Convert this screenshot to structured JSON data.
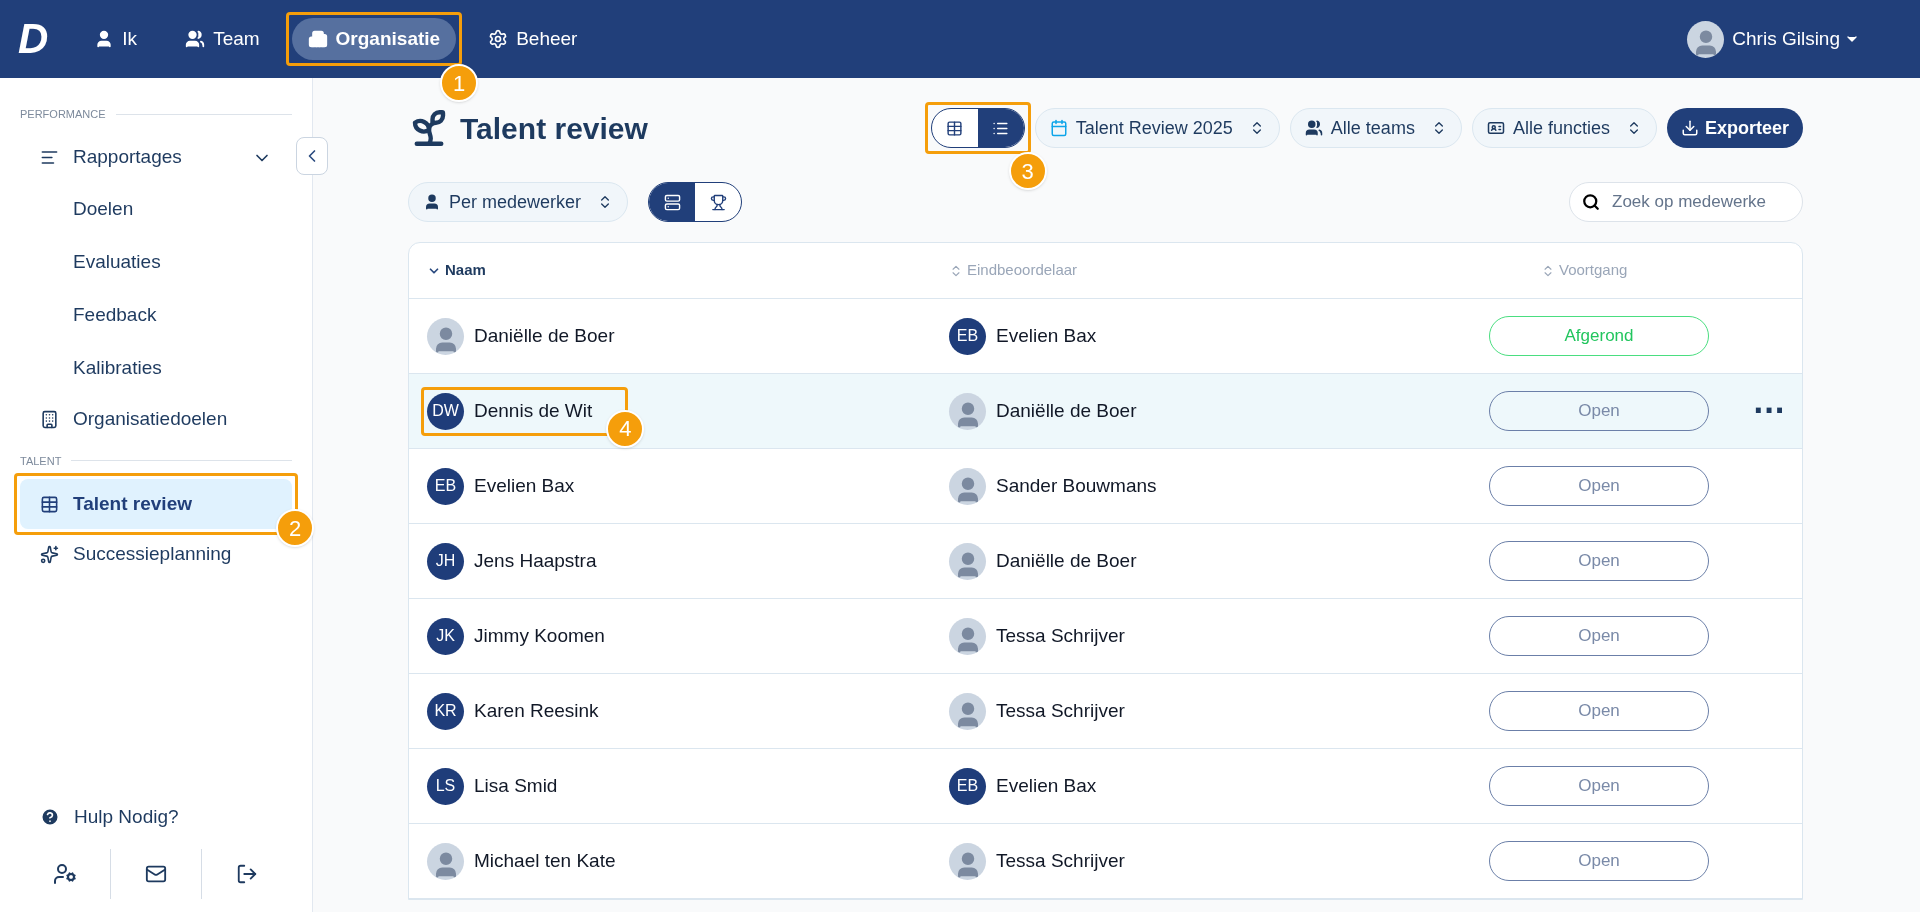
{
  "topbar": {
    "logo": "D",
    "nav": [
      {
        "label": "Ik",
        "selected": false
      },
      {
        "label": "Team",
        "selected": false
      },
      {
        "label": "Organisatie",
        "selected": true,
        "callout": "1"
      },
      {
        "label": "Beheer",
        "selected": false
      }
    ],
    "user": {
      "name": "Chris Gilsing"
    }
  },
  "sidebar": {
    "sections": [
      {
        "label": "PERFORMANCE",
        "items": [
          {
            "label": "Rapportages",
            "expanded": true,
            "selected": false,
            "children": [
              {
                "label": "Doelen",
                "selected": false
              },
              {
                "label": "Evaluaties",
                "selected": false
              },
              {
                "label": "Feedback",
                "selected": false
              },
              {
                "label": "Kalibraties",
                "selected": false
              }
            ]
          },
          {
            "label": "Organisatiedoelen",
            "selected": false
          }
        ]
      },
      {
        "label": "TALENT",
        "items": [
          {
            "label": "Talent review",
            "selected": true,
            "callout": "2"
          },
          {
            "label": "Successieplanning",
            "selected": false
          }
        ]
      }
    ],
    "help": "Hulp Nodig?"
  },
  "page": {
    "title": "Talent review",
    "view_toggle": {
      "callout": "3",
      "options": [
        {
          "selected": false
        },
        {
          "selected": true
        }
      ]
    },
    "filters": [
      {
        "label": "Talent Review 2025"
      },
      {
        "label": "Alle teams"
      },
      {
        "label": "Alle functies"
      }
    ],
    "export": "Exporteer",
    "group_select": "Per medewerker",
    "mode_toggle": [
      {
        "selected": true
      },
      {
        "selected": false
      }
    ],
    "search": {
      "placeholder": "Zoek op medewerke"
    }
  },
  "table": {
    "columns": [
      {
        "label": "Naam",
        "sorted": true
      },
      {
        "label": "Eindbeoordelaar",
        "sorted": false
      },
      {
        "label": "Voortgang",
        "sorted": false
      }
    ],
    "rows": [
      {
        "name": {
          "label": "Daniëlle de Boer",
          "avatar": {
            "kind": "photo"
          }
        },
        "reviewer": {
          "label": "Evelien Bax",
          "avatar": {
            "kind": "initials",
            "initials": "EB"
          }
        },
        "status": {
          "label": "Afgerond",
          "kind": "done"
        },
        "selected": false
      },
      {
        "name": {
          "label": "Dennis de Wit",
          "avatar": {
            "kind": "initials",
            "initials": "DW"
          },
          "callout": "4"
        },
        "reviewer": {
          "label": "Daniëlle de Boer",
          "avatar": {
            "kind": "photo"
          }
        },
        "status": {
          "label": "Open",
          "kind": "open"
        },
        "selected": true,
        "menu": "···"
      },
      {
        "name": {
          "label": "Evelien Bax",
          "avatar": {
            "kind": "initials",
            "initials": "EB"
          }
        },
        "reviewer": {
          "label": "Sander Bouwmans",
          "avatar": {
            "kind": "photo"
          }
        },
        "status": {
          "label": "Open",
          "kind": "open"
        },
        "selected": false
      },
      {
        "name": {
          "label": "Jens Haapstra",
          "avatar": {
            "kind": "initials",
            "initials": "JH"
          }
        },
        "reviewer": {
          "label": "Daniëlle de Boer",
          "avatar": {
            "kind": "photo"
          }
        },
        "status": {
          "label": "Open",
          "kind": "open"
        },
        "selected": false
      },
      {
        "name": {
          "label": "Jimmy Koomen",
          "avatar": {
            "kind": "initials",
            "initials": "JK"
          }
        },
        "reviewer": {
          "label": "Tessa Schrijver",
          "avatar": {
            "kind": "photo"
          }
        },
        "status": {
          "label": "Open",
          "kind": "open"
        },
        "selected": false
      },
      {
        "name": {
          "label": "Karen Reesink",
          "avatar": {
            "kind": "initials",
            "initials": "KR"
          }
        },
        "reviewer": {
          "label": "Tessa Schrijver",
          "avatar": {
            "kind": "photo"
          }
        },
        "status": {
          "label": "Open",
          "kind": "open"
        },
        "selected": false
      },
      {
        "name": {
          "label": "Lisa Smid",
          "avatar": {
            "kind": "initials",
            "initials": "LS"
          }
        },
        "reviewer": {
          "label": "Evelien Bax",
          "avatar": {
            "kind": "initials",
            "initials": "EB"
          }
        },
        "status": {
          "label": "Open",
          "kind": "open"
        },
        "selected": false
      },
      {
        "name": {
          "label": "Michael ten Kate",
          "avatar": {
            "kind": "photo"
          }
        },
        "reviewer": {
          "label": "Tessa Schrijver",
          "avatar": {
            "kind": "photo"
          }
        },
        "status": {
          "label": "Open",
          "kind": "open"
        },
        "selected": false
      }
    ]
  }
}
